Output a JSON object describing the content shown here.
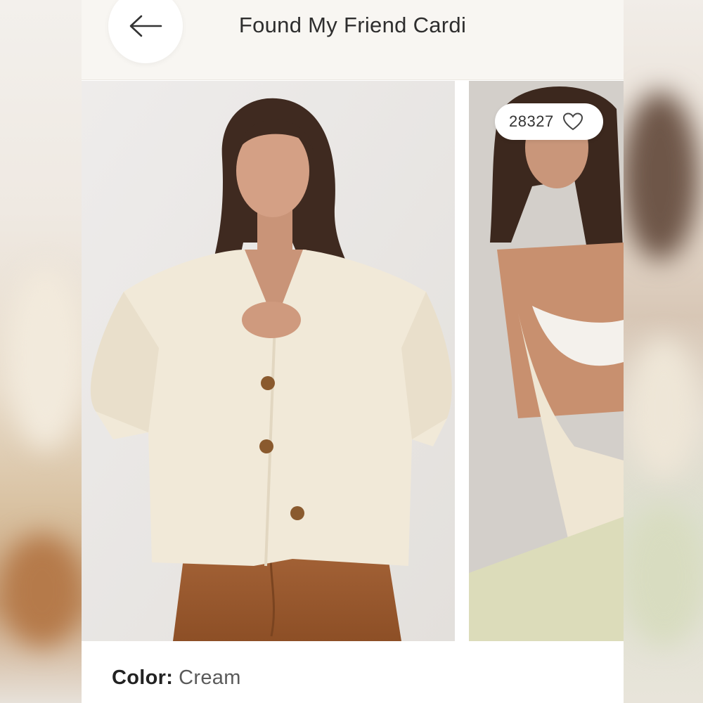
{
  "header": {
    "title": "Found My Friend Cardi",
    "back_icon": "arrow-left-icon"
  },
  "carousel": {
    "like_count": "28327",
    "like_icon": "heart-outline-icon",
    "images": [
      {
        "subject": "model-cream-cardigan-front"
      },
      {
        "subject": "model-cream-cardigan-off-shoulder"
      }
    ]
  },
  "details": {
    "color_label": "Color:",
    "color_value": "Cream"
  },
  "colors": {
    "header_bg": "#f8f6f2",
    "sweater": "#f1e9d8",
    "pants": "#9a5a2e"
  }
}
